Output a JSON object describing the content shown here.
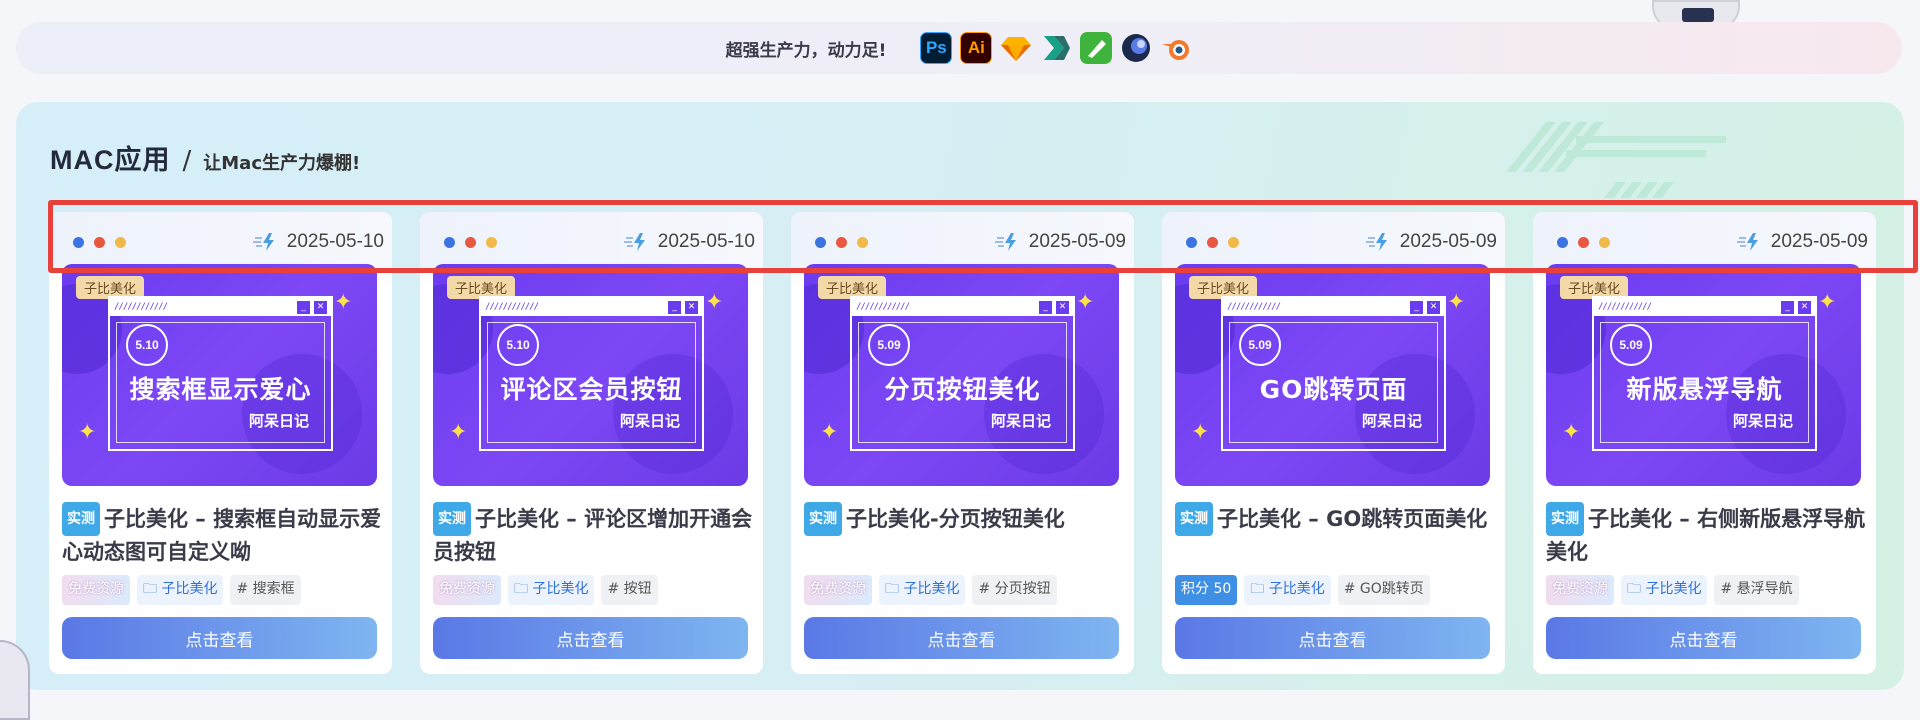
{
  "banner": {
    "text": "超强生产力，动力足!",
    "apps": [
      {
        "label": "Ps",
        "icon": "photoshop-icon"
      },
      {
        "label": "Ai",
        "icon": "illustrator-icon"
      },
      {
        "label": "",
        "icon": "sketch-icon"
      },
      {
        "label": "",
        "icon": "axure-icon"
      },
      {
        "label": "",
        "icon": "vectornator-icon"
      },
      {
        "label": "",
        "icon": "cinema4d-icon"
      },
      {
        "label": "",
        "icon": "blender-icon"
      }
    ]
  },
  "section": {
    "title": "MAC应用",
    "subtitle": "让Mac生产力爆棚!"
  },
  "common": {
    "view_button": "点击查看",
    "thumb_tag": "子比美化",
    "thumb_sign": "阿呆日记",
    "test_badge": "实测",
    "cat_tag": "子比美化",
    "free_tag": "免费资源"
  },
  "cards": [
    {
      "date": "2025-05-10",
      "ver": "5.10",
      "thumb_title": "搜索框显示爱心",
      "title": "子比美化 – 搜索框自动显示爱心动态图可自定义呦",
      "price_tag": "免费资源",
      "keyword": "# 搜索框"
    },
    {
      "date": "2025-05-10",
      "ver": "5.10",
      "thumb_title": "评论区会员按钮",
      "title": "子比美化 – 评论区增加开通会员按钮",
      "price_tag": "免费资源",
      "keyword": "# 按钮"
    },
    {
      "date": "2025-05-09",
      "ver": "5.09",
      "thumb_title": "分页按钮美化",
      "title": "子比美化-分页按钮美化",
      "price_tag": "免费资源",
      "keyword": "# 分页按钮"
    },
    {
      "date": "2025-05-09",
      "ver": "5.09",
      "thumb_title": "GO跳转页面",
      "title": "子比美化 – GO跳转页面美化",
      "price_tag": "积分 50",
      "keyword": "# GO跳转页"
    },
    {
      "date": "2025-05-09",
      "ver": "5.09",
      "thumb_title": "新版悬浮导航",
      "title": "子比美化 – 右侧新版悬浮导航美化",
      "price_tag": "免费资源",
      "keyword": "# 悬浮导航"
    }
  ]
}
